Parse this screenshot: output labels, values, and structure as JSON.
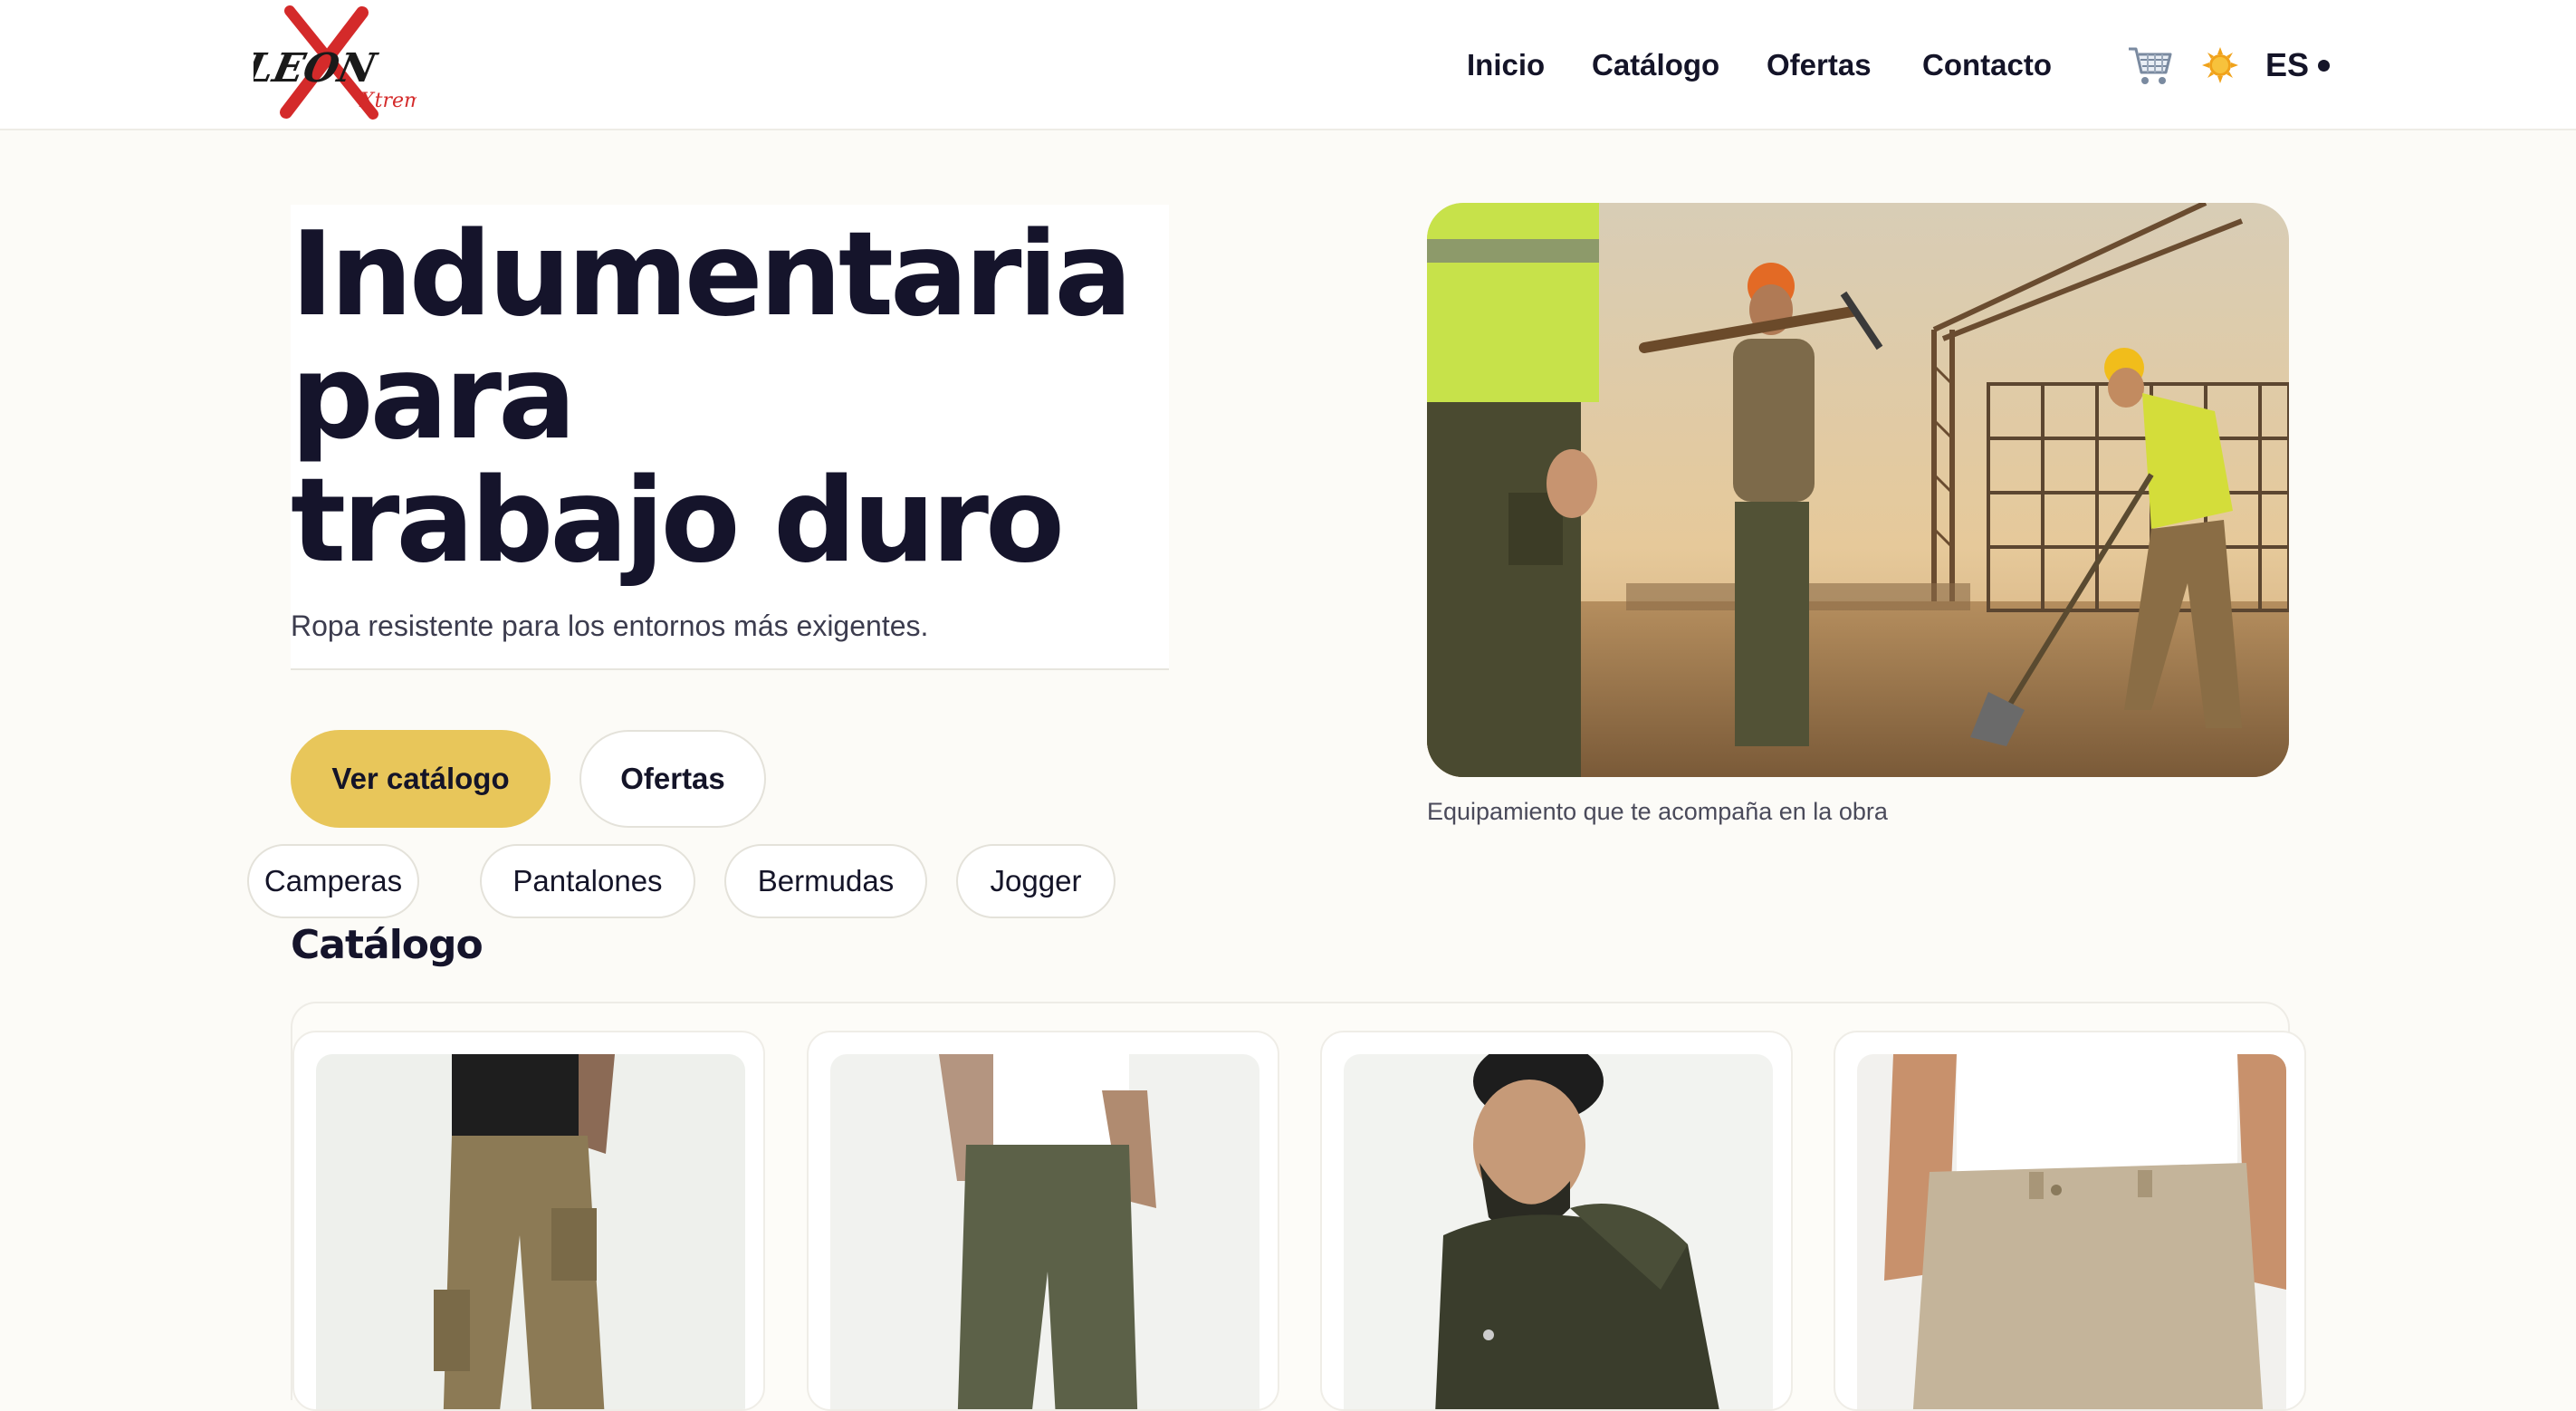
{
  "brand": {
    "logo_text_1": "LEON",
    "logo_text_2": "Xtrem"
  },
  "nav": {
    "links": [
      "Inicio",
      "Catálogo",
      "Ofertas",
      "Contacto"
    ],
    "cart_icon": "cart-icon",
    "theme_icon": "sun-icon",
    "language": "ES"
  },
  "hero": {
    "title_lines": [
      "Indumentaria",
      "para",
      "trabajo duro"
    ],
    "subtitle": "Ropa resistente para los entornos más exigentes.",
    "primary_cta": "Ver catálogo",
    "secondary_cta": "Ofertas",
    "image_caption": "Equipamiento que te acompaña en la obra"
  },
  "categories": [
    "Camperas",
    "Pantalones",
    "Bermudas",
    "Jogger"
  ],
  "catalog": {
    "title": "Catálogo",
    "items": [
      {
        "image": "khaki-cargo-pants"
      },
      {
        "image": "olive-chino-pants"
      },
      {
        "image": "olive-hooded-jacket"
      },
      {
        "image": "beige-work-pants"
      }
    ]
  },
  "colors": {
    "accent": "#e8c65a",
    "text": "#141428",
    "background": "#fcfbf7",
    "logo_red": "#d42a2a"
  }
}
